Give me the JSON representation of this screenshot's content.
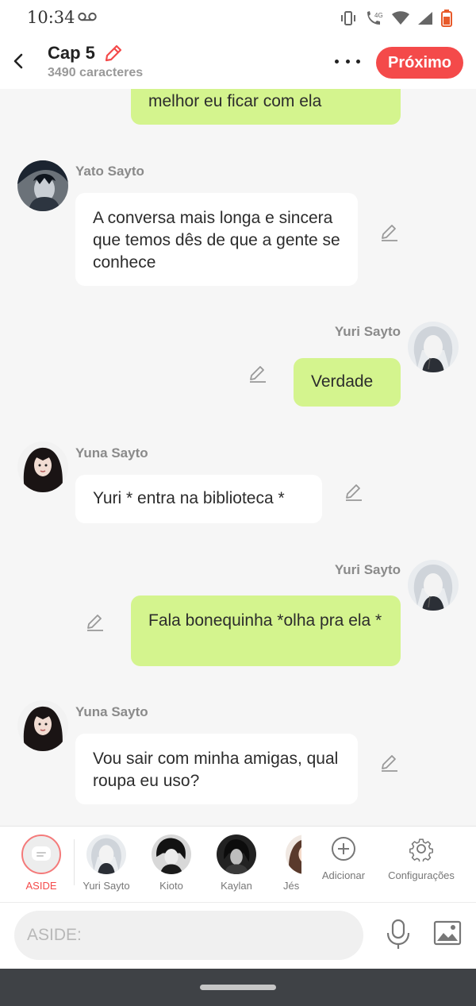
{
  "status_bar": {
    "time": "10:34"
  },
  "header": {
    "chapter_title": "Cap 5",
    "char_count": "3490 caracteres",
    "next_label": "Próximo"
  },
  "colors": {
    "accent": "#f44a4a",
    "bubble_right": "#d4f48e",
    "bubble_left": "#ffffff",
    "background": "#f6f6f6"
  },
  "messages": [
    {
      "side": "right",
      "speaker": "",
      "text": "melhor eu ficar com ela"
    },
    {
      "side": "left",
      "speaker": "Yato Sayto",
      "text": "A conversa mais longa e sincera que temos dês de que a gente se conhece"
    },
    {
      "side": "right",
      "speaker": "Yuri Sayto",
      "text": "Verdade"
    },
    {
      "side": "left",
      "speaker": "Yuna Sayto",
      "text": "Yuri * entra na biblioteca *"
    },
    {
      "side": "right",
      "speaker": "Yuri Sayto",
      "text": "Fala bonequinha *olha pra ela *"
    },
    {
      "side": "left",
      "speaker": "Yuna Sayto",
      "text": "Vou sair com minha amigas, qual roupa eu uso?"
    }
  ],
  "characters": [
    {
      "label": "ASIDE",
      "icon": "aside-chat-icon",
      "selected": true
    },
    {
      "label": "Yuri Sayto"
    },
    {
      "label": "Kioto"
    },
    {
      "label": "Kaylan"
    },
    {
      "label": "Jés"
    }
  ],
  "tools": {
    "add_label": "Adicionar",
    "settings_label": "Configurações"
  },
  "input": {
    "placeholder": "ASIDE:"
  },
  "icons": [
    "back-arrow-icon",
    "pencil-icon",
    "more-dots-icon",
    "microphone-icon",
    "image-icon",
    "add-circle-icon",
    "gear-icon",
    "voicemail-icon",
    "vibrate-icon",
    "wifi-call-icon",
    "wifi-icon",
    "signal-icon",
    "battery-icon"
  ]
}
